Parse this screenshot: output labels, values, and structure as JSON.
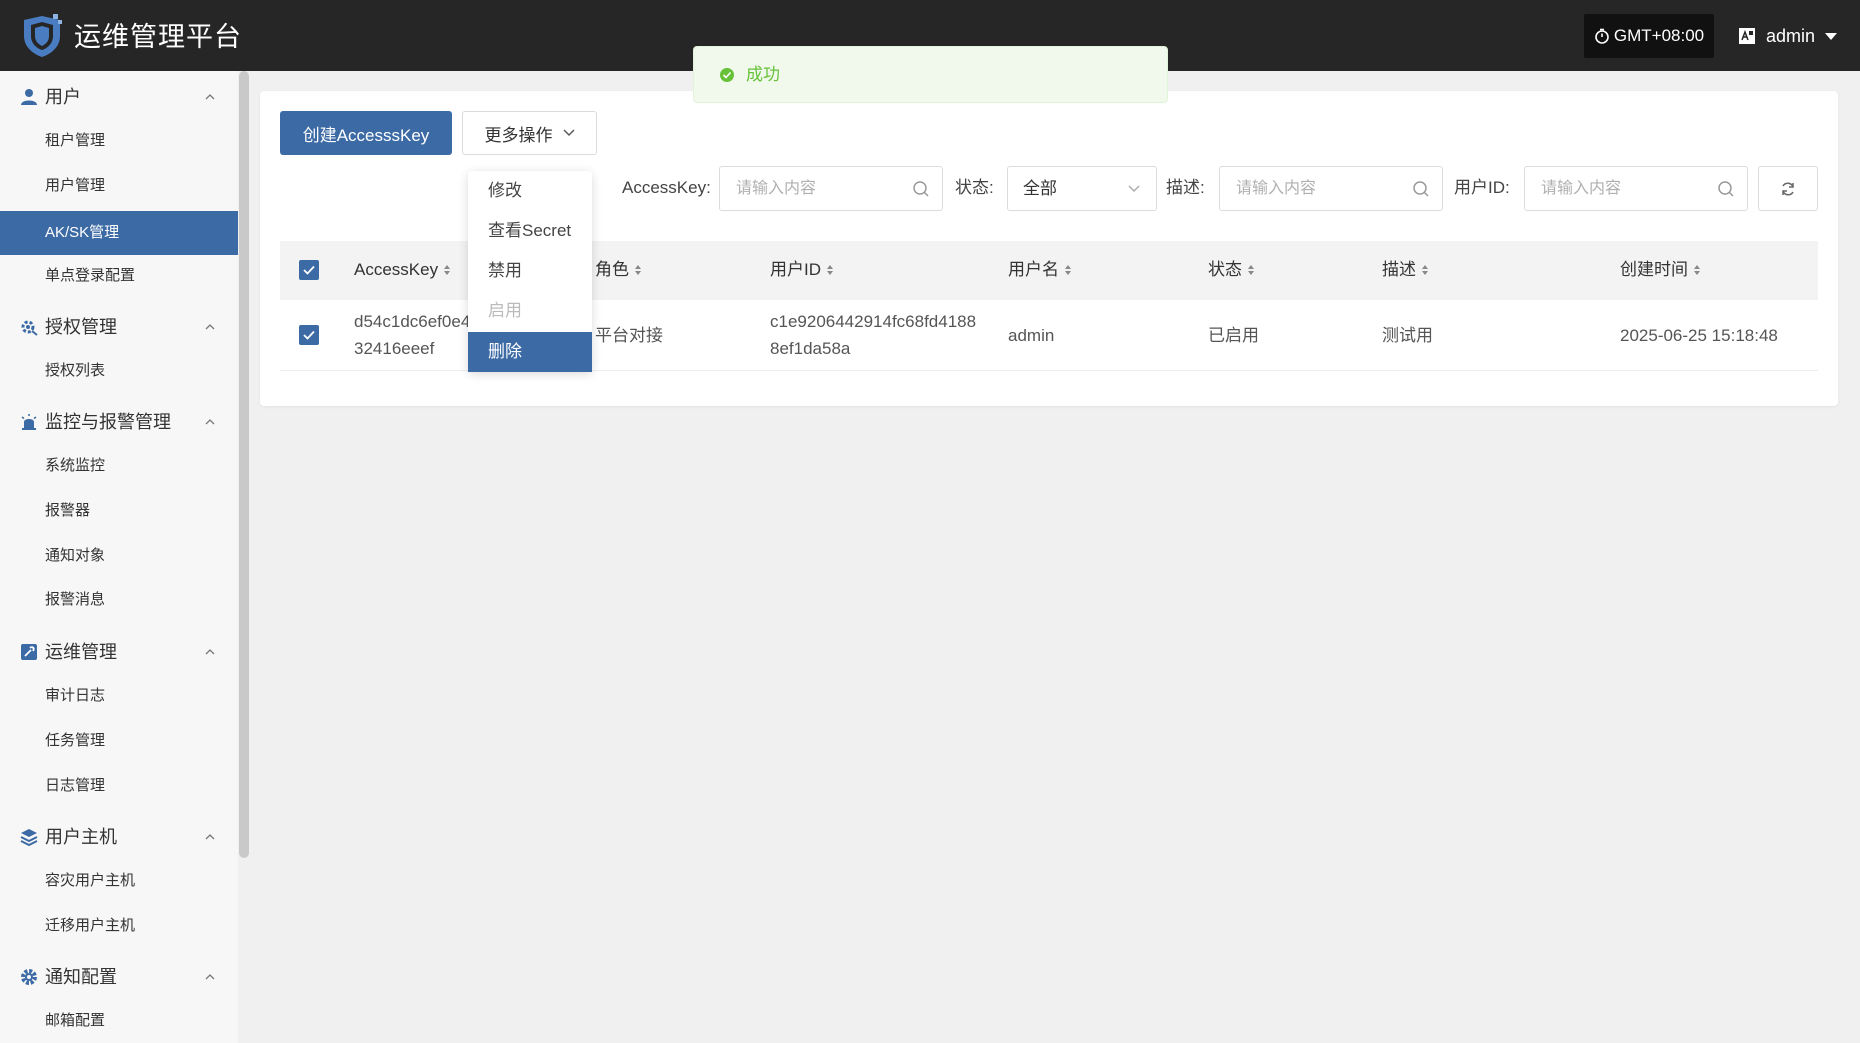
{
  "header": {
    "brand": "运维管理平台",
    "timezone": "GMT+08:00",
    "username": "admin"
  },
  "sidebar": {
    "groups": [
      {
        "label": "用户",
        "icon": "user-icon",
        "items": [
          "租户管理",
          "用户管理",
          "AK/SK管理",
          "单点登录配置"
        ]
      },
      {
        "label": "授权管理",
        "icon": "gear-key-icon",
        "items": [
          "授权列表"
        ]
      },
      {
        "label": "监控与报警管理",
        "icon": "alarm-icon",
        "items": [
          "系统监控",
          "报警器",
          "通知对象",
          "报警消息"
        ]
      },
      {
        "label": "运维管理",
        "icon": "maintenance-icon",
        "items": [
          "审计日志",
          "任务管理",
          "日志管理"
        ]
      },
      {
        "label": "用户主机",
        "icon": "layers-icon",
        "items": [
          "容灾用户主机",
          "迁移用户主机"
        ]
      },
      {
        "label": "通知配置",
        "icon": "gear-icon",
        "items": [
          "邮箱配置"
        ]
      }
    ],
    "active_item": "AK/SK管理"
  },
  "toolbar": {
    "create_label": "创建AccesssKey",
    "more_label": "更多操作"
  },
  "more_menu": {
    "items": [
      {
        "label": "修改",
        "state": "normal"
      },
      {
        "label": "查看Secret",
        "state": "normal"
      },
      {
        "label": "禁用",
        "state": "normal"
      },
      {
        "label": "启用",
        "state": "disabled"
      },
      {
        "label": "删除",
        "state": "hover"
      }
    ]
  },
  "filters": {
    "accesskey_label": "AccessKey:",
    "accesskey_placeholder": "请输入内容",
    "status_label": "状态:",
    "status_value": "全部",
    "desc_label": "描述:",
    "desc_placeholder": "请输入内容",
    "userid_label": "用户ID:",
    "userid_placeholder": "请输入内容"
  },
  "table": {
    "columns": [
      "AccessKey",
      "角色",
      "用户ID",
      "用户名",
      "状态",
      "描述",
      "创建时间"
    ],
    "rows": [
      {
        "accesskey_line1": "d54c1dc6ef0e4",
        "accesskey_line2": "32416eeef",
        "role": "平台对接",
        "userid_line1": "c1e9206442914fc68fd4188",
        "userid_line2": "8ef1da58a",
        "username": "admin",
        "status": "已启用",
        "desc": "测试用",
        "created": "2025-06-25 15:18:48",
        "checked": true
      }
    ]
  },
  "toast": {
    "message": "成功",
    "color": "#67c23a"
  },
  "colors": {
    "primary": "#3c6aa5",
    "topbar": "#262626"
  }
}
